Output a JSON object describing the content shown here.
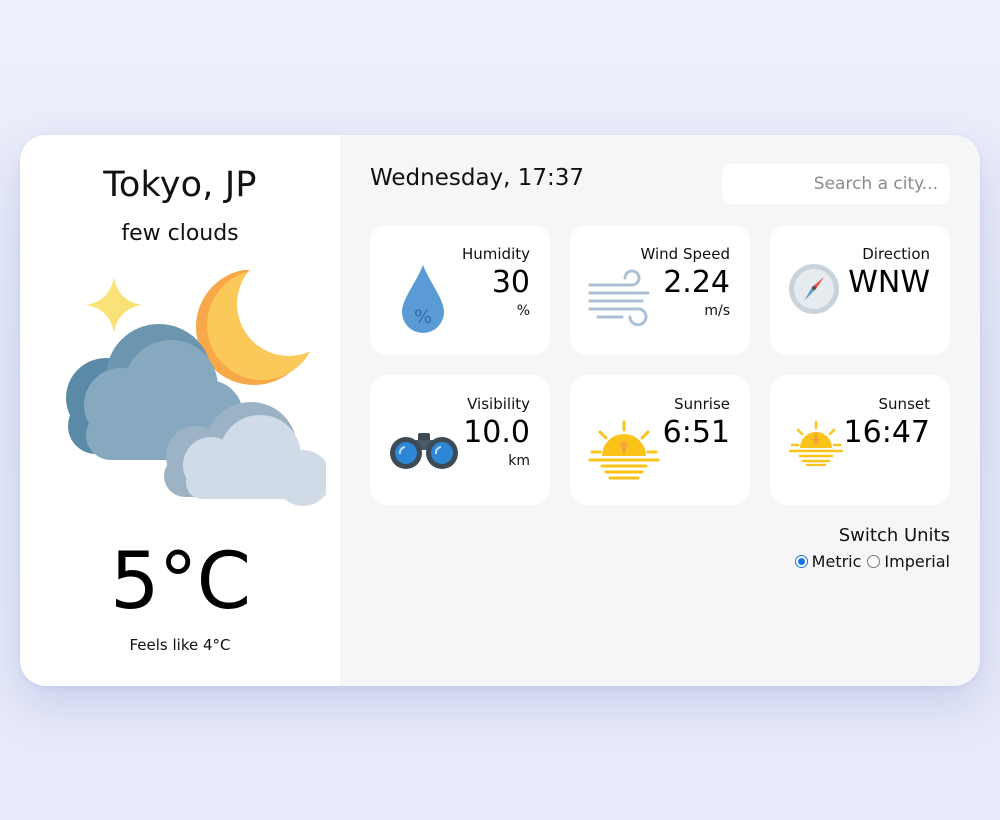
{
  "location": {
    "city": "Tokyo, JP",
    "description": "few clouds"
  },
  "current": {
    "temperature": "5°C",
    "feels_like": "Feels like 4°C",
    "condition_icon": "cloud-moon-icon"
  },
  "header": {
    "datetime": "Wednesday, 17:37",
    "search_placeholder": "Search a city..."
  },
  "tiles": [
    {
      "label": "Humidity",
      "value": "30",
      "unit": "%",
      "icon": "humidity-drop-icon"
    },
    {
      "label": "Wind Speed",
      "value": "2.24",
      "unit": "m/s",
      "icon": "wind-icon"
    },
    {
      "label": "Direction",
      "value": "WNW",
      "unit": "",
      "icon": "compass-icon"
    },
    {
      "label": "Visibility",
      "value": "10.0",
      "unit": "km",
      "icon": "binoculars-icon"
    },
    {
      "label": "Sunrise",
      "value": "6:51",
      "unit": "",
      "icon": "sunrise-icon"
    },
    {
      "label": "Sunset",
      "value": "16:47",
      "unit": "",
      "icon": "sunset-icon"
    }
  ],
  "units": {
    "title": "Switch Units",
    "metric_label": "Metric",
    "imperial_label": "Imperial",
    "selected": "Metric"
  },
  "colors": {
    "accent": "#1a73e8",
    "sun": "#f9c31a",
    "moon": "#f8c14a",
    "cloud_dark": "#7fa4bd",
    "cloud_light": "#d1dbe8",
    "drop": "#5a9bd5"
  }
}
